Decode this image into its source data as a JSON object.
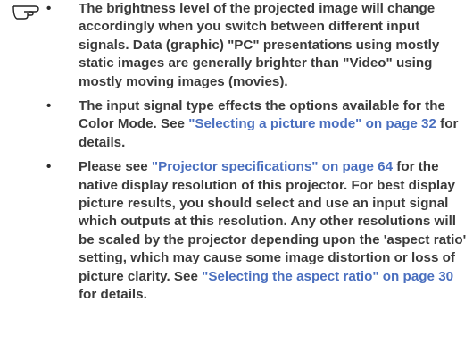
{
  "note": {
    "icon": "pointing-hand-icon",
    "items": [
      {
        "segments": [
          {
            "text": "The brightness level of the projected image will change accordingly when you switch between different input signals. Data (graphic) \"PC\" presentations using mostly static images are generally brighter than \"Video\" using mostly moving images (movies).",
            "link": false
          }
        ]
      },
      {
        "segments": [
          {
            "text": "The input signal type effects the options available for the Color Mode. See ",
            "link": false
          },
          {
            "text": "\"Selecting a picture mode\" on page 32",
            "link": true
          },
          {
            "text": " for details.",
            "link": false
          }
        ]
      },
      {
        "segments": [
          {
            "text": "Please see ",
            "link": false
          },
          {
            "text": "\"Projector specifications\" on page 64",
            "link": true
          },
          {
            "text": " for the native display resolution of this projector. For best display picture results, you should select and use an input signal which outputs at this resolution. Any other resolutions will be scaled by the projector depending upon the 'aspect ratio' setting, which may cause some image distortion or loss of picture clarity. See ",
            "link": false
          },
          {
            "text": "\"Selecting the aspect ratio\" on page 30",
            "link": true
          },
          {
            "text": " for details.",
            "link": false
          }
        ]
      }
    ]
  },
  "colors": {
    "body_text": "#3b3b3b",
    "link_text": "#4a6fbf"
  }
}
